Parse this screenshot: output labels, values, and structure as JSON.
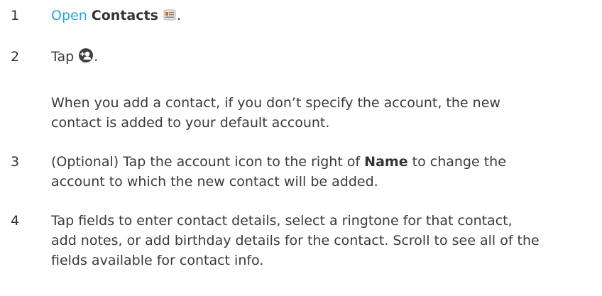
{
  "steps": [
    {
      "number": "1",
      "link": "Open",
      "app_name": "Contacts",
      "trailing": "."
    },
    {
      "number": "2",
      "text_before": "Tap",
      "trailing": ".",
      "note_lines": [
        "When you add a contact, if you don’t specify the account, the new",
        "contact is added to your default account."
      ]
    },
    {
      "number": "3",
      "line1_before": "(Optional) Tap the account icon to the right of",
      "line1_bold": "Name",
      "line1_after": "to change the",
      "line2": "account to which the new contact will be added."
    },
    {
      "number": "4",
      "lines": [
        "Tap fields to enter contact details, select a ringtone for that contact,",
        "add notes, or add birthday details for the contact. Scroll to see all of the",
        "fields available for contact info."
      ]
    }
  ],
  "icons": {
    "contacts_app": "contacts-app-icon",
    "add_contact": "add-contact-icon"
  },
  "colors": {
    "link": "#2ba4d8",
    "text": "#3a3a3a"
  }
}
